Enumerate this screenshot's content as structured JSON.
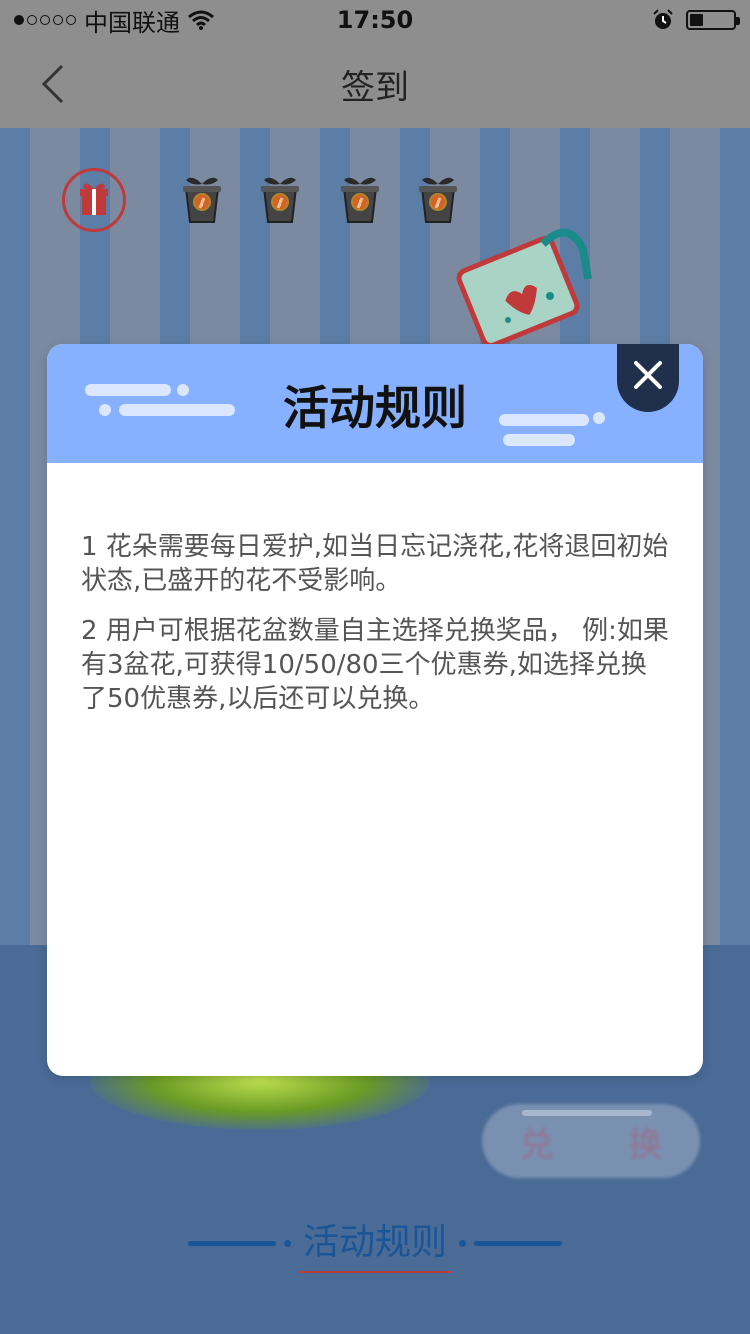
{
  "status_bar": {
    "carrier": "中国联通",
    "time": "17:50",
    "battery_level": 0.3
  },
  "nav": {
    "title": "签到"
  },
  "pots": [
    {
      "icon": "locked-pot-icon"
    },
    {
      "icon": "locked-pot-icon"
    },
    {
      "icon": "locked-pot-icon"
    },
    {
      "icon": "locked-pot-icon"
    }
  ],
  "exchange_button": {
    "label_left": "兑",
    "label_right": "换"
  },
  "footer": {
    "rules_link": "活动规则"
  },
  "modal": {
    "title": "活动规则",
    "rules": [
      "1 花朵需要每日爱护,如当日忘记浇花,花将退回初始状态,已盛开的花不受影响。",
      "2 用户可根据花盆数量自主选择兑换奖品，  例:如果有3盆花,可获得10/50/80三个优惠券,如选择兑换了50优惠券,以后还可以兑换。"
    ]
  },
  "colors": {
    "modal_header": "#87b1fe",
    "close_button": "#1f2f4c",
    "accent_red": "#c0393b",
    "link_blue": "#1a5598"
  }
}
